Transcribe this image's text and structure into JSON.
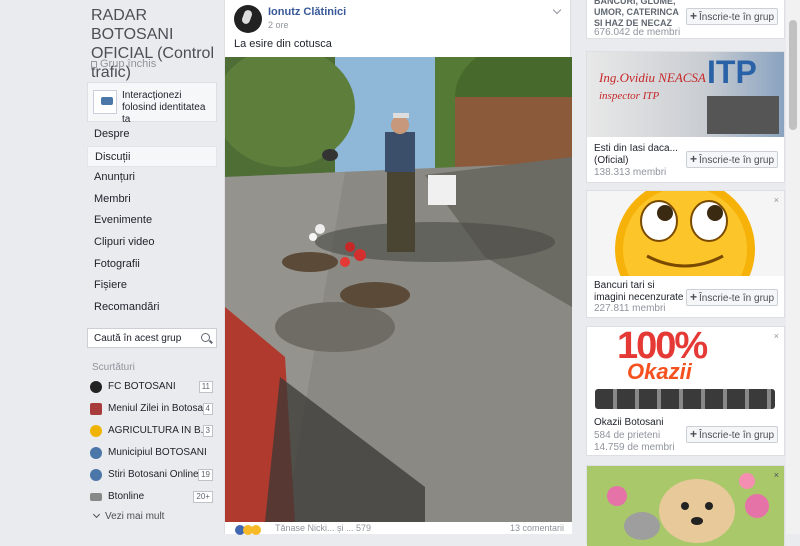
{
  "group": {
    "title": "RADAR BOTOSANI OFICIAL (Control trafic)",
    "type": "Grup închis",
    "identity_text": "Interacționezi folosind identitatea ta"
  },
  "nav": {
    "items": [
      "Despre",
      "Discuții",
      "Anunțuri",
      "Membri",
      "Evenimente",
      "Clipuri video",
      "Fotografii",
      "Fișiere",
      "Recomandări"
    ],
    "active": "Discuții"
  },
  "search": {
    "placeholder": "Caută în acest grup"
  },
  "shortcuts": {
    "heading": "Scurtături",
    "items": [
      {
        "label": "FC BOTOSANI",
        "count": "11",
        "color": "#222222"
      },
      {
        "label": "Meniul Zilei in Botosani",
        "count": "4",
        "color": "#a83c3c"
      },
      {
        "label": "AGRICULTURA IN B...",
        "count": "3",
        "color": "#f0b400"
      },
      {
        "label": "Municipiul BOTOSANI",
        "count": "",
        "color": "#4a76a8"
      },
      {
        "label": "Stiri Botosani Online",
        "count": "19",
        "color": "#4a76a8"
      },
      {
        "label": "Btonline",
        "count": "20+",
        "color": "#888888"
      }
    ],
    "more": "Vezi mai mult"
  },
  "post": {
    "author": "Ionutz Clătinici",
    "time": "2 ore",
    "text": "La esire din cotusca",
    "reactions_text": "Tănase Nicki... și ... 579",
    "comments_text": "13 comentarii"
  },
  "suggestions": [
    {
      "name": "BANCURI, GLUME, UMOR, CATERINCA SI HAZ DE NECAZ",
      "members": "676.042 de membri",
      "join": "Înscrie-te în grup"
    },
    {
      "name": "Esti din Iasi daca... (Oficial)",
      "members": "138.313 membri",
      "join": "Înscrie-te în grup",
      "ad_title": "Ing.Ovidiu NEACSA",
      "ad_sub": "inspector ITP",
      "ad_brand": "ITP"
    },
    {
      "name": "Bancuri tari si imagini necenzurate",
      "members": "227.811 membri",
      "join": "Înscrie-te în grup",
      "close": "×"
    },
    {
      "name": "Okazii Botosani",
      "members_line1": "584 de prieteni",
      "members": "14.759 de membri",
      "join": "Înscrie-te în grup",
      "close": "×",
      "ad_big": "100%",
      "ad_brand": "Okazii"
    },
    {
      "close": "×"
    }
  ]
}
